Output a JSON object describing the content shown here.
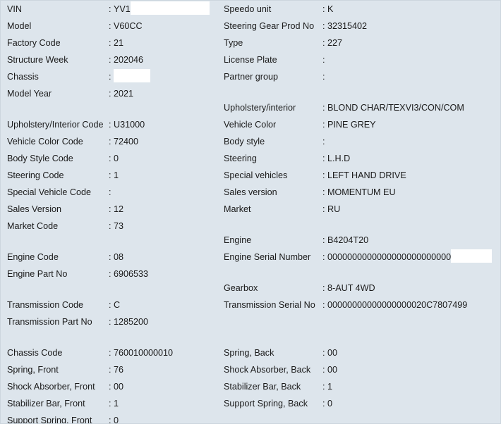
{
  "background_color": "#dde5ec",
  "text_color": "#1a1a1a",
  "redaction_color": "#ffffff",
  "separator": ":",
  "sections": [
    {
      "name": "vehicle-identity",
      "left": [
        {
          "label": "VIN",
          "value": "YV1",
          "redacted": true,
          "redact_width": 112
        },
        {
          "label": "Model",
          "value": "V60CC"
        },
        {
          "label": "Factory Code",
          "value": "21"
        },
        {
          "label": "Structure Week",
          "value": "202046"
        },
        {
          "label": "Chassis",
          "value": "",
          "redacted": true,
          "redact_width": 52
        },
        {
          "label": "Model Year",
          "value": "2021"
        }
      ],
      "right": [
        {
          "label": "Speedo unit",
          "value": "K"
        },
        {
          "label": "Steering Gear Prod No",
          "value": "32315402"
        },
        {
          "label": "Type",
          "value": "227"
        },
        {
          "label": "License Plate",
          "value": ""
        },
        {
          "label": "Partner group",
          "value": ""
        }
      ]
    },
    {
      "name": "trim-and-market",
      "left": [
        {
          "label": "Upholstery/Interior Code",
          "value": "U31000"
        },
        {
          "label": "Vehicle Color Code",
          "value": "72400"
        },
        {
          "label": "Body Style Code",
          "value": "0"
        },
        {
          "label": "Steering Code",
          "value": "1"
        },
        {
          "label": "Special Vehicle Code",
          "value": ""
        },
        {
          "label": "Sales Version",
          "value": "12"
        },
        {
          "label": "Market Code",
          "value": "73"
        }
      ],
      "right": [
        {
          "label": "Upholstery/interior",
          "value": "BLOND CHAR/TEXVI3/CON/COM"
        },
        {
          "label": "Vehicle Color",
          "value": "PINE GREY"
        },
        {
          "label": "Body style",
          "value": ""
        },
        {
          "label": "Steering",
          "value": "L.H.D"
        },
        {
          "label": "Special vehicles",
          "value": "LEFT HAND DRIVE"
        },
        {
          "label": "Sales version",
          "value": "MOMENTUM EU"
        },
        {
          "label": "Market",
          "value": "RU"
        }
      ]
    },
    {
      "name": "engine",
      "left": [
        {
          "label": "Engine Code",
          "value": "08"
        },
        {
          "label": "Engine Part No",
          "value": "6906533"
        }
      ],
      "right": [
        {
          "label": "Engine",
          "value": "B4204T20"
        },
        {
          "label": "Engine Serial Number",
          "value": "0000000000000000000000000",
          "redacted": true,
          "redact_width": 58
        }
      ]
    },
    {
      "name": "transmission",
      "left": [
        {
          "label": "Transmission Code",
          "value": "C"
        },
        {
          "label": "Transmission Part No",
          "value": "1285200"
        }
      ],
      "right": [
        {
          "label": "Gearbox",
          "value": "8-AUT 4WD"
        },
        {
          "label": "Transmission Serial No",
          "value": "00000000000000000020C7807499"
        }
      ]
    },
    {
      "name": "chassis-suspension",
      "left": [
        {
          "label": "Chassis Code",
          "value": "760010000010"
        },
        {
          "label": "Spring, Front",
          "value": "76"
        },
        {
          "label": "Shock Absorber, Front",
          "value": "00"
        },
        {
          "label": "Stabilizer Bar, Front",
          "value": "1"
        },
        {
          "label": "Support Spring, Front",
          "value": "0"
        }
      ],
      "right": [
        {
          "label": "",
          "value": "",
          "blank": true
        },
        {
          "label": "Spring, Back",
          "value": "00"
        },
        {
          "label": "Shock Absorber, Back",
          "value": "00"
        },
        {
          "label": "Stabilizer Bar, Back",
          "value": "1"
        },
        {
          "label": "Support Spring, Back",
          "value": "0"
        }
      ]
    }
  ]
}
